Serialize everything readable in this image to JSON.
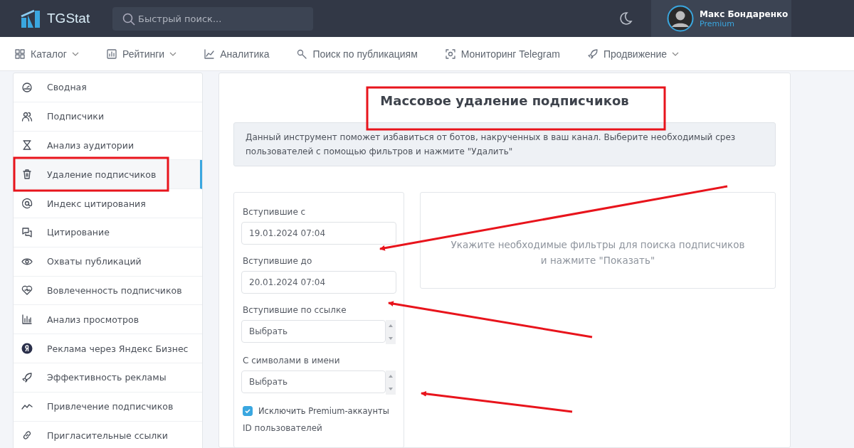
{
  "header": {
    "logo": "TGStat",
    "search": {
      "placeholder": "Быстрый поиск..."
    },
    "user": {
      "name": "Макс Бондаренко",
      "plan": "Premium"
    }
  },
  "nav": [
    {
      "label": "Каталог",
      "dropdown": true
    },
    {
      "label": "Рейтинги",
      "dropdown": true
    },
    {
      "label": "Аналитика",
      "dropdown": false
    },
    {
      "label": "Поиск по публикациям",
      "dropdown": false
    },
    {
      "label": "Мониторинг Telegram",
      "dropdown": false
    },
    {
      "label": "Продвижение",
      "dropdown": true
    }
  ],
  "sidebar": {
    "items": [
      {
        "label": "Сводная",
        "selected": false
      },
      {
        "label": "Подписчики",
        "selected": false
      },
      {
        "label": "Анализ аудитории",
        "selected": false
      },
      {
        "label": "Удаление подписчиков",
        "selected": true
      },
      {
        "label": "Индекс цитирования",
        "selected": false
      },
      {
        "label": "Цитирование",
        "selected": false
      },
      {
        "label": "Охваты публикаций",
        "selected": false
      },
      {
        "label": "Вовлеченность подписчиков",
        "selected": false
      },
      {
        "label": "Анализ просмотров",
        "selected": false
      },
      {
        "label": "Реклама через Яндекс Бизнес",
        "selected": false
      },
      {
        "label": "Эффективность рекламы",
        "selected": false
      },
      {
        "label": "Привлечение подписчиков",
        "selected": false
      },
      {
        "label": "Пригласительные ссылки",
        "selected": false
      }
    ]
  },
  "main": {
    "title": "Массовое удаление подписчиков",
    "info": "Данный инструмент поможет избавиться от ботов, накрученных в ваш канал. Выберите необходимый срез пользователей с помощью фильтров и нажмите \"Удалить\"",
    "filters": [
      {
        "kind": "date",
        "label": "Вступившие с",
        "value": "19.01.2024 07:04"
      },
      {
        "kind": "date",
        "label": "Вступившие до",
        "value": "20.01.2024 07:04"
      },
      {
        "kind": "select",
        "label": "Вступившие по ссылке",
        "placeholder": "Выбрать"
      },
      {
        "kind": "select",
        "label": "С символами в имени",
        "placeholder": "Выбрать"
      },
      {
        "kind": "checkbox",
        "label": "Исключить Premium-аккаунты",
        "checked": true
      },
      {
        "kind": "heading",
        "label": "ID пользователей"
      }
    ],
    "result_hint": "Укажите необходимые фильтры для поиска подписчиков и нажмите \"Показать\""
  },
  "annotations": [
    {
      "kind": "box"
    },
    {
      "kind": "box"
    },
    {
      "kind": "arrow"
    },
    {
      "kind": "arrow"
    },
    {
      "kind": "arrow"
    }
  ]
}
